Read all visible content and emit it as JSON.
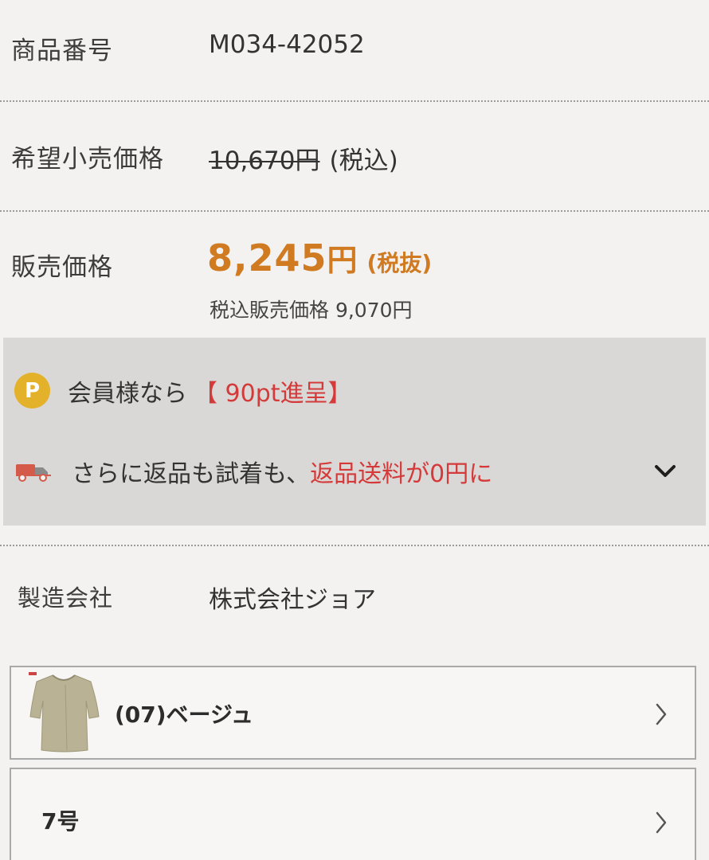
{
  "product": {
    "code_label": "商品番号",
    "code_value": "M034-42052",
    "msrp_label": "希望小売価格",
    "msrp_value": "10,670円",
    "msrp_note": "(税込)",
    "sale_label": "販売価格",
    "sale_number": "8,245",
    "sale_yen": "円",
    "sale_note": "(税抜)",
    "tax_included_text": "税込販売価格 9,070円"
  },
  "promo": {
    "points_icon_letter": "P",
    "points_prefix": "会員様なら",
    "points_highlight": "【 90pt進呈】",
    "shipping_prefix": "さらに返品も試着も、",
    "shipping_highlight": "返品送料が0円に",
    "expand_icon": "chevron-down-icon",
    "points_icon": "points-icon",
    "truck_icon": "truck-icon"
  },
  "maker": {
    "label": "製造会社",
    "value": "株式会社ジョア"
  },
  "selectors": {
    "color_label": "(07)ベージュ",
    "size_label": "7号",
    "arrow_icon": "chevron-right-icon"
  },
  "colors": {
    "price_orange": "#d07a22",
    "accent_red": "#d43a3a",
    "points_yellow": "#e3b12a",
    "promo_bg": "#d9d8d6"
  }
}
